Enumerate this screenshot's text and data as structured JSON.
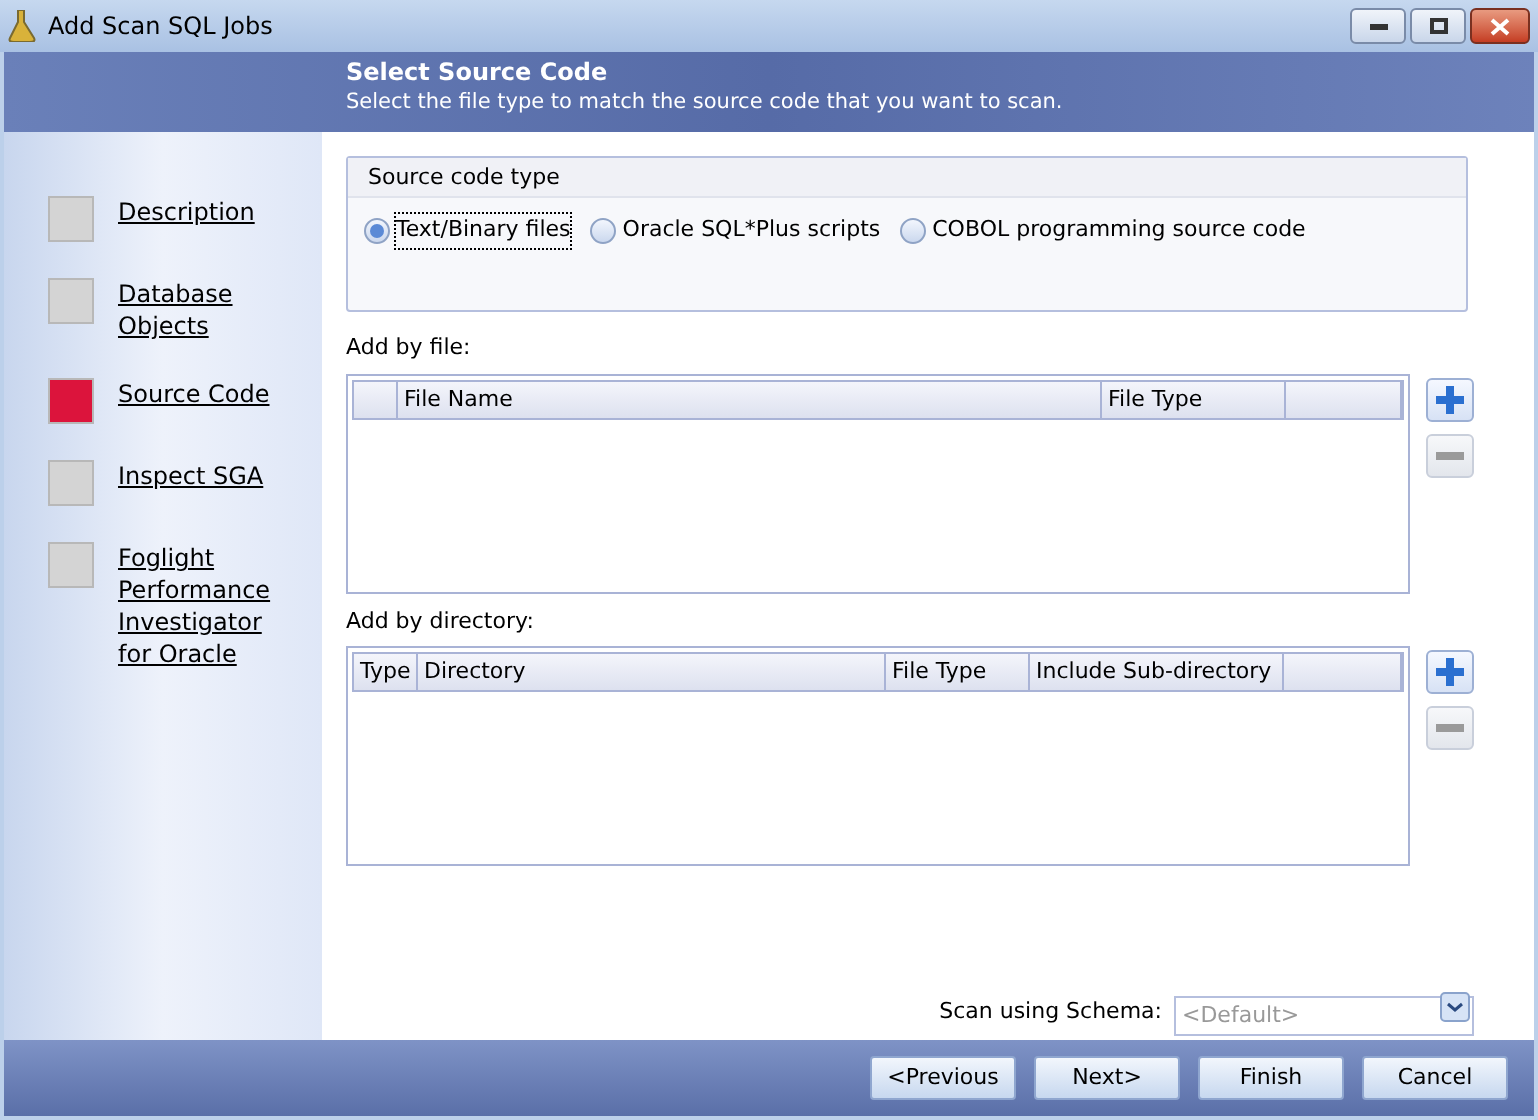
{
  "window": {
    "title": "Add Scan SQL Jobs"
  },
  "header": {
    "title": "Select Source Code",
    "subtitle": "Select the file type to match the source code that you want to scan."
  },
  "steps": [
    {
      "label": "Description",
      "selected": false
    },
    {
      "label": "Database Objects",
      "selected": false
    },
    {
      "label": "Source Code",
      "selected": true
    },
    {
      "label": "Inspect SGA",
      "selected": false
    },
    {
      "label": "Foglight Performance Investigator for Oracle",
      "selected": false
    }
  ],
  "source_code_type": {
    "title": "Source code type",
    "options": [
      {
        "label": "Text/Binary files",
        "selected": true
      },
      {
        "label": "Oracle SQL*Plus scripts",
        "selected": false
      },
      {
        "label": "COBOL programming source code",
        "selected": false
      }
    ]
  },
  "add_by_file": {
    "label": "Add by file:",
    "columns": [
      "",
      "File Name",
      "File Type",
      ""
    ]
  },
  "add_by_directory": {
    "label": "Add by directory:",
    "columns": [
      "Type",
      "Directory",
      "File Type",
      "Include Sub-directory",
      ""
    ]
  },
  "schema": {
    "label": "Scan using Schema:",
    "placeholder": "<Default>"
  },
  "buttons": [
    "<Previous",
    "Next>",
    "Finish",
    "Cancel"
  ]
}
